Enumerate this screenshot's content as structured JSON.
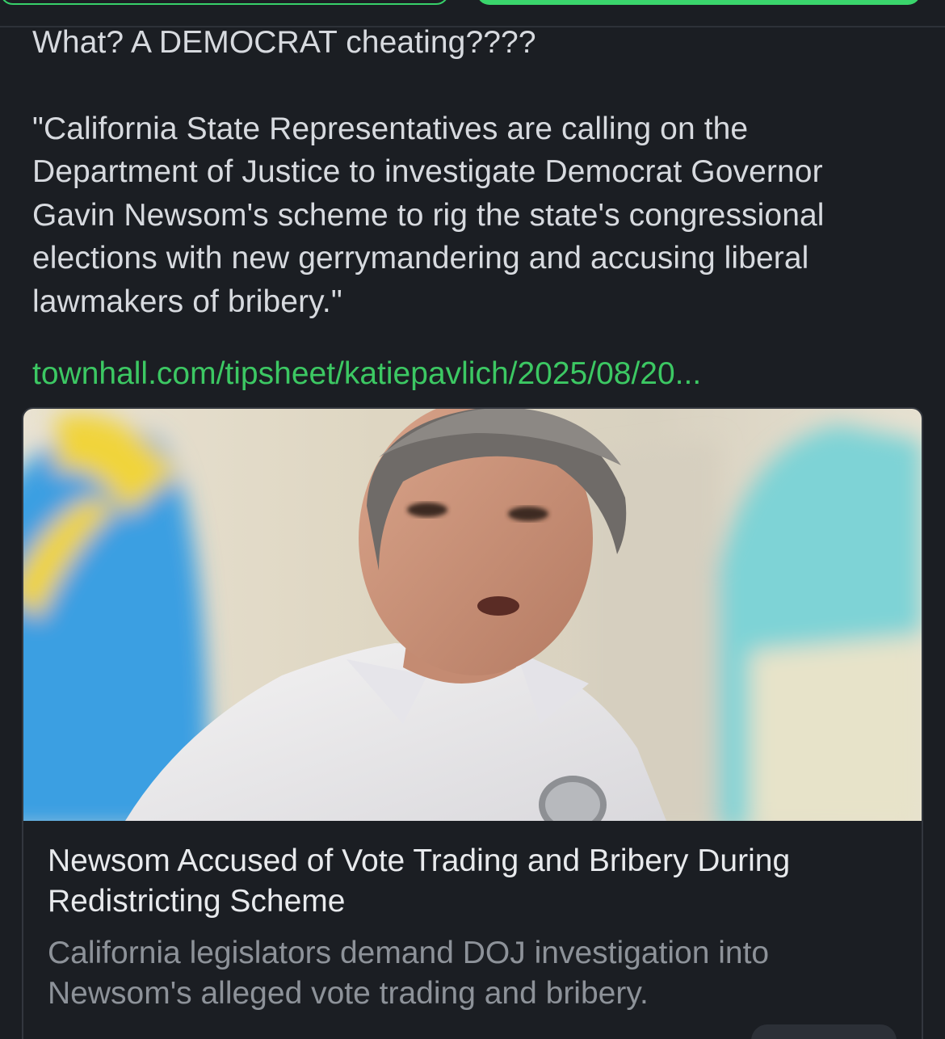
{
  "post": {
    "line1": "What? A DEMOCRAT cheating????",
    "quote": "\"California State Representatives are calling on the Department of Justice to investigate Democrat Governor Gavin Newsom's scheme to rig the state's congressional elections with new gerrymandering and accusing liberal lawmakers of bribery.\"",
    "link_text": "townhall.com/tipsheet/katiepavlich/2025/08/20..."
  },
  "card": {
    "image_name": "gavin-newsom-photo",
    "title": "Newsom Accused of Vote Trading and Bribery During Redistricting Scheme",
    "description": "California legislators demand DOJ investigation into Newsom's alleged vote trading and bribery."
  },
  "colors": {
    "background": "#1b1e23",
    "accent": "#3ad56c",
    "text": "#d7dadf",
    "muted": "#8d9299"
  }
}
